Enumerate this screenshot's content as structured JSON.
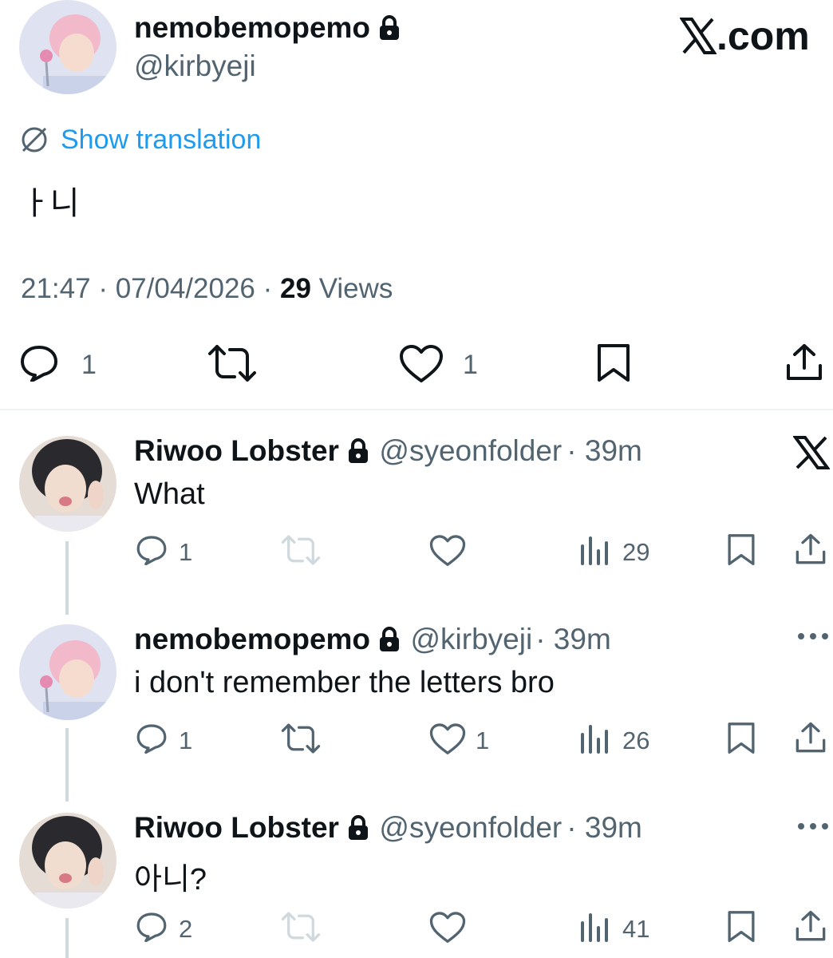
{
  "main_tweet": {
    "author_name": "nemobemopemo",
    "author_handle": "@kirbyeji",
    "site_label": ".com",
    "translate_label": "Show translation",
    "text": "ㅏ니",
    "time": "21:47",
    "date": "07/04/2026",
    "views_count": "29",
    "views_label": "Views",
    "reply_count": "1",
    "like_count": "1"
  },
  "replies": [
    {
      "author_name": "Riwoo Lobster",
      "author_handle": "@syeonfolder",
      "time": "· 39m",
      "text": "What",
      "reply_count": "1",
      "like_count": "",
      "views": "29"
    },
    {
      "author_name": "nemobemopemo",
      "author_handle": "@kirbyeji",
      "time": "· 39m",
      "text": "i don't remember the letters bro",
      "reply_count": "1",
      "like_count": "1",
      "views": "26"
    },
    {
      "author_name": "Riwoo Lobster",
      "author_handle": "@syeonfolder",
      "time": "· 39m",
      "text": "아니?",
      "reply_count": "2",
      "like_count": "",
      "views": "41"
    }
  ],
  "colors": {
    "link": "#1d9bf0",
    "secondary": "#536471",
    "thread_line": "#cfd9de"
  }
}
